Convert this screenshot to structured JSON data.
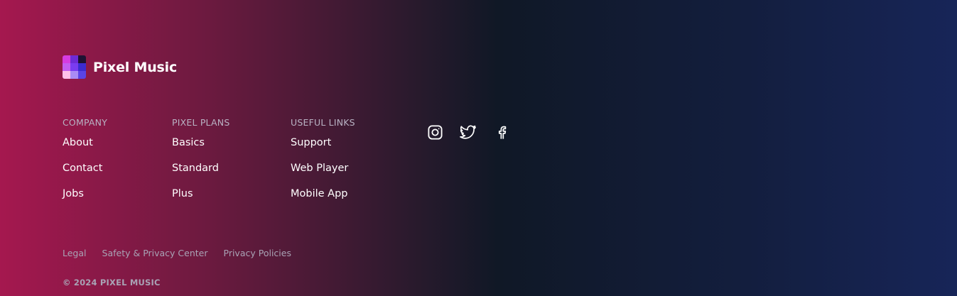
{
  "brand": {
    "name": "Pixel Music",
    "logo_colors": [
      "#d63ce0",
      "#6d2bd6",
      "#1f1233",
      "#c45cf0",
      "#7a3cf0",
      "#3d2bd0",
      "#ffc0ea",
      "#a98cf5",
      "#5a44e6"
    ]
  },
  "columns": [
    {
      "heading": "COMPANY",
      "links": [
        "About",
        "Contact",
        "Jobs"
      ]
    },
    {
      "heading": "PIXEL PLANS",
      "links": [
        "Basics",
        "Standard",
        "Plus"
      ]
    },
    {
      "heading": "USEFUL LINKS",
      "links": [
        "Support",
        "Web Player",
        "Mobile App"
      ]
    }
  ],
  "social": [
    "instagram-icon",
    "twitter-icon",
    "facebook-icon"
  ],
  "legal_links": [
    "Legal",
    "Safety & Privacy Center",
    "Privacy Policies"
  ],
  "copyright": "© 2024 PIXEL MUSIC",
  "colors": {
    "gradient_left": "#a5184f",
    "gradient_mid": "#101826",
    "gradient_right": "#172558"
  }
}
